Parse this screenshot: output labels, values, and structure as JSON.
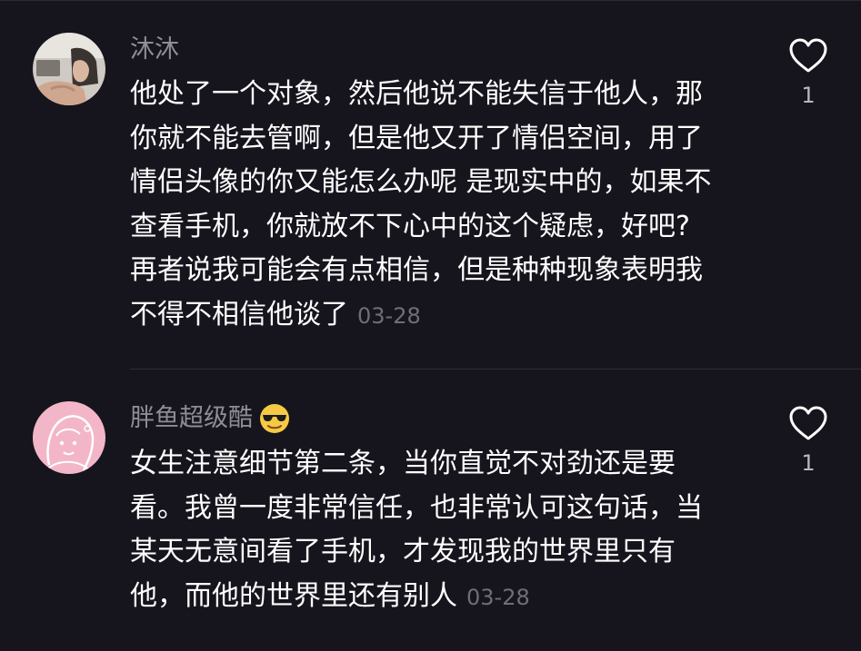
{
  "comments": [
    {
      "username": "沐沐",
      "lines": [
        "他处了一个对象，然后他说不能失信于他人，那",
        "你就不能去管啊，但是他又开了情侣空间，用了",
        "情侣头像的你又能怎么办呢 是现实中的，如果不",
        "查看手机，你就放不下心中的这个疑虑，好吧?",
        "再者说我可能会有点相信，但是种种现象表明我",
        "不得不相信他谈了"
      ],
      "date": "03-28",
      "likes": "1",
      "avatar_icon": "photo-avatar"
    },
    {
      "username": "胖鱼超级酷",
      "username_emoji": "sunglasses-emoji",
      "lines": [
        "女生注意细节第二条，当你直觉不对劲还是要",
        "看。我曾一度非常信任，也非常认可这句话，当",
        "某天无意间看了手机，才发现我的世界里只有",
        "他，而他的世界里还有别人"
      ],
      "date": "03-28",
      "likes": "1",
      "avatar_icon": "pink-illustration-avatar"
    }
  ],
  "icons": {
    "like": "heart-outline-icon"
  },
  "colors": {
    "background": "#16151d",
    "username": "#8e8d96",
    "text": "#ffffff",
    "date": "#6f6e77",
    "like_count": "#b8b7c0"
  }
}
